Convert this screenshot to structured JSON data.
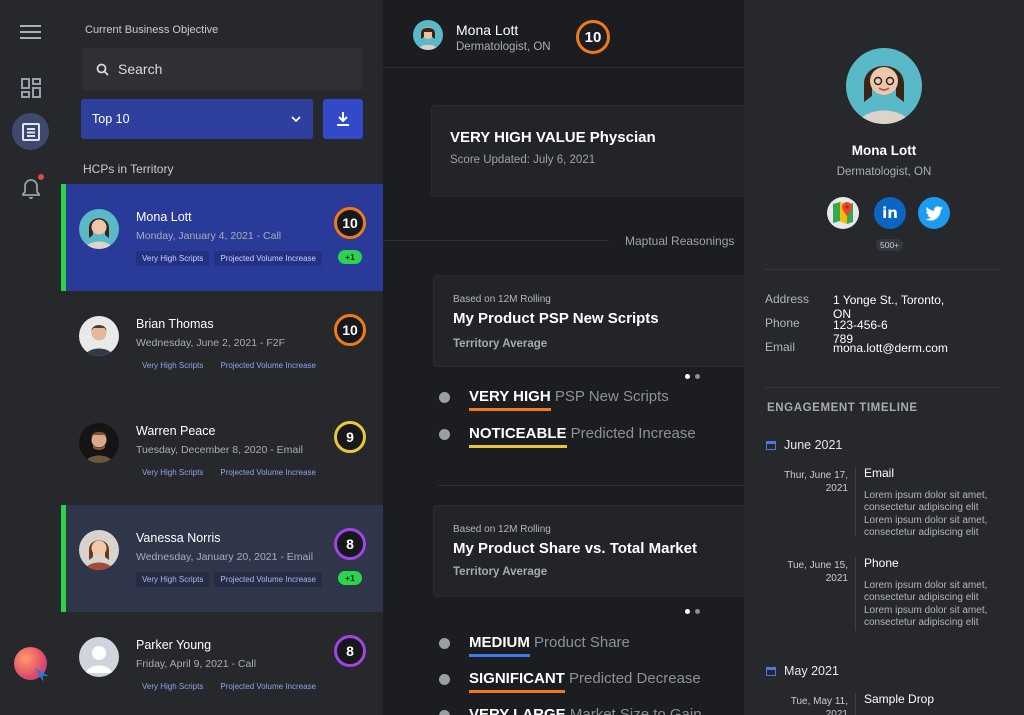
{
  "nav": {
    "menu_icon": "menu-icon",
    "dashboard_icon": "dashboard-icon",
    "list_icon": "list-icon",
    "bell_icon": "bell-icon"
  },
  "panel": {
    "objective_label": "Current Business Objective",
    "search_placeholder": "Search",
    "filter_value": "Top 10",
    "section_label": "HCPs in Territory"
  },
  "hcps": [
    {
      "name": "Mona Lott",
      "sub": "Monday, January 4, 2021 - Call",
      "score": "10",
      "tags": [
        "Very High Scripts",
        "Projected Volume Increase"
      ],
      "badge": "+1"
    },
    {
      "name": "Brian Thomas",
      "sub": "Wednesday, June 2, 2021 - F2F",
      "score": "10",
      "tags": [
        "Very High Scripts",
        "Projected Volume Increase"
      ]
    },
    {
      "name": "Warren Peace",
      "sub": "Tuesday, December 8, 2020 - Email",
      "score": "9",
      "tags": [
        "Very High Scripts",
        "Projected Volume Increase"
      ]
    },
    {
      "name": "Vanessa Norris",
      "sub": "Wednesday, January 20, 2021 - Email",
      "score": "8",
      "tags": [
        "Very High Scripts",
        "Projected Volume Increase"
      ],
      "badge": "+1"
    },
    {
      "name": "Parker Young",
      "sub": "Friday, April 9, 2021 - Call",
      "score": "8",
      "tags": [
        "Very High Scripts",
        "Projected Volume Increase"
      ]
    }
  ],
  "header": {
    "name": "Mona Lott",
    "sub": "Dermatologist, ON",
    "score": "10"
  },
  "value_card": {
    "title": "VERY HIGH VALUE Physcian",
    "updated": "Score Updated: July 6, 2021"
  },
  "reasonings_label": "Maptual Reasonings",
  "metrics": [
    {
      "small": "Based on 12M Rolling",
      "title": "My Product PSP New Scripts",
      "foot": "Territory Average"
    },
    {
      "small": "Based on 12M Rolling",
      "title": "My Product Share vs. Total Market",
      "foot": "Territory Average"
    }
  ],
  "bullets1": [
    {
      "strong": "VERY HIGH",
      "rest": "PSP New Scripts",
      "color": "#f07a1a"
    },
    {
      "strong": "NOTICEABLE",
      "rest": "Predicted Increase",
      "color": "#e8c83a"
    }
  ],
  "bullets2": [
    {
      "strong": "MEDIUM",
      "rest": "Product Share",
      "color": "#3f7bf0"
    },
    {
      "strong": "SIGNIFICANT",
      "rest": "Predicted Decrease",
      "color": "#f07a1a"
    },
    {
      "strong": "VERY LARGE",
      "rest": "Market Size to Gain",
      "color": "#f07a1a"
    }
  ],
  "profile": {
    "name": "Mona Lott",
    "sub": "Dermatologist, ON",
    "followers": "500+",
    "address_label": "Address",
    "address": "1 Yonge St., Toronto, ON",
    "phone_label": "Phone",
    "phone": "123-456-6 789",
    "email_label": "Email",
    "email": "mona.lott@derm.com",
    "timeline_label": "ENGAGEMENT TIMELINE",
    "months": [
      "June 2021",
      "May 2021"
    ],
    "events": [
      {
        "date": "Thur, June 17, 2021",
        "title": "Email",
        "text": "Lorem ipsum dolor sit amet, consectetur adipiscing elit Lorem ipsum dolor sit amet, consectetur adipiscing elit"
      },
      {
        "date": "Tue, June 15, 2021",
        "title": "Phone",
        "text": "Lorem ipsum dolor sit amet, consectetur adipiscing elit Lorem ipsum dolor sit amet, consectetur adipiscing elit"
      },
      {
        "date": "Tue, May 11, 2021",
        "title": "Sample Drop",
        "text": ""
      }
    ]
  }
}
